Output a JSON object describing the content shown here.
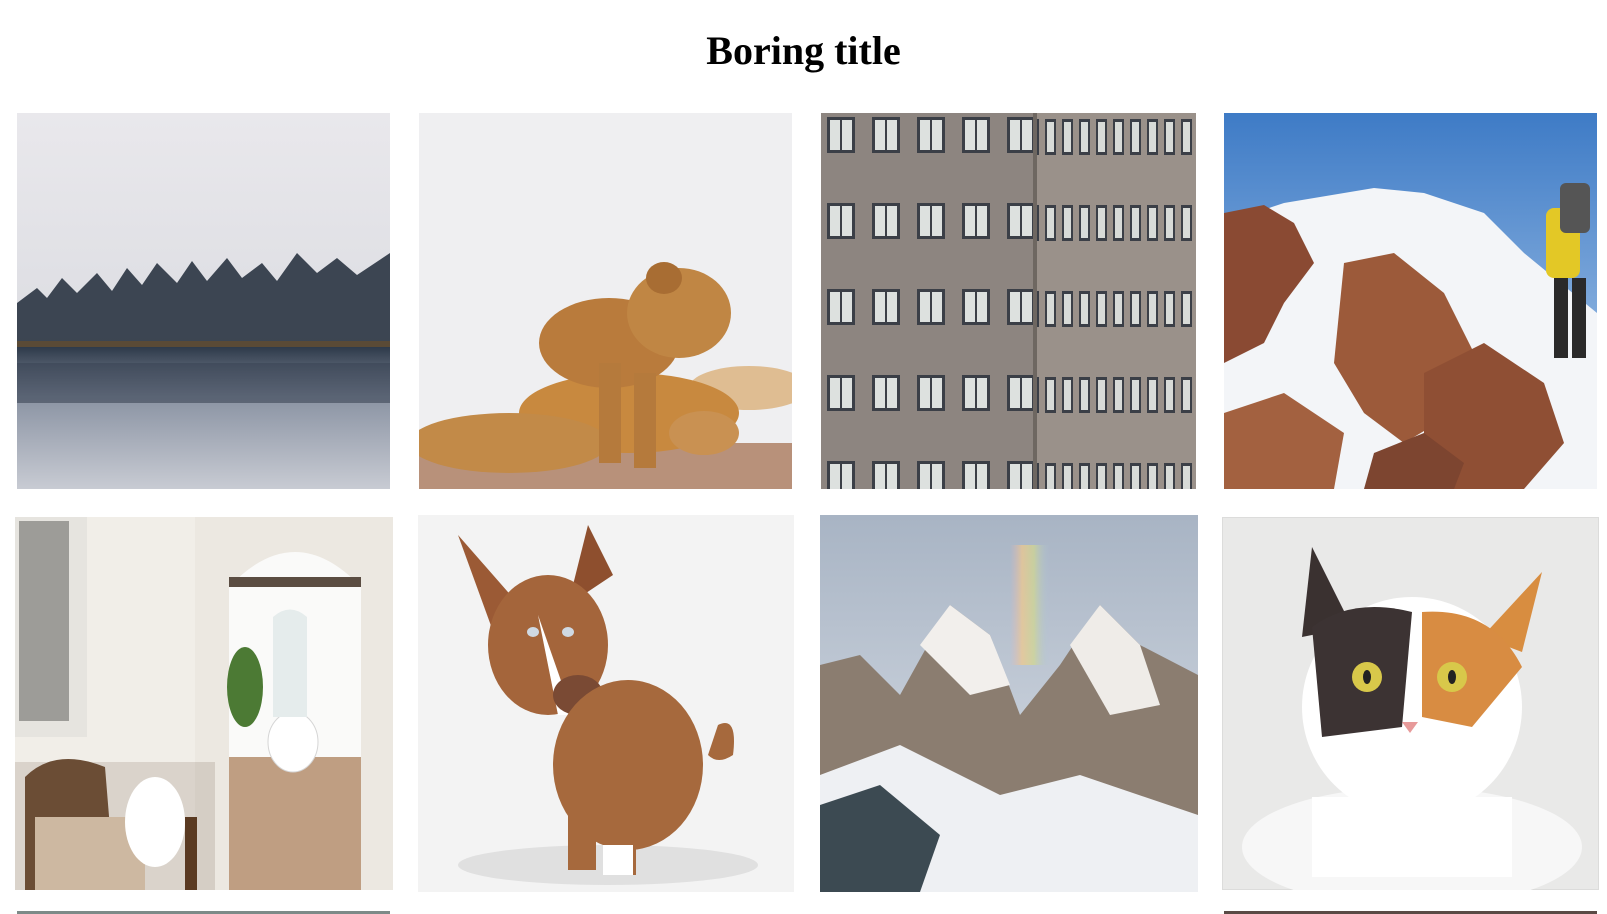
{
  "page": {
    "title": "Boring title"
  },
  "gallery": {
    "images": [
      {
        "subject": "misty-forest-lake"
      },
      {
        "subject": "lion-cubs"
      },
      {
        "subject": "office-building-windows"
      },
      {
        "subject": "snowy-mountain-climber"
      },
      {
        "subject": "bright-hallway-bathroom"
      },
      {
        "subject": "brown-dog-sitting"
      },
      {
        "subject": "snowy-mountain-peaks-rainbow"
      },
      {
        "subject": "calico-cat"
      }
    ]
  },
  "colors": {
    "background": "#ffffff",
    "title": "#000000"
  }
}
